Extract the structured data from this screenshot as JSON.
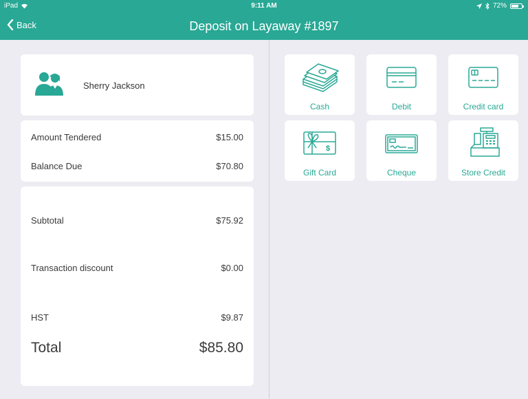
{
  "status_bar": {
    "carrier": "iPad",
    "time": "9:11 AM",
    "battery": "72%"
  },
  "nav": {
    "back_label": "Back",
    "title": "Deposit on Layaway #1897"
  },
  "customer": {
    "name": "Sherry Jackson"
  },
  "tender": {
    "amount_tendered_label": "Amount Tendered",
    "amount_tendered_value": "$15.00",
    "balance_due_label": "Balance Due",
    "balance_due_value": "$70.80"
  },
  "summary": {
    "subtotal_label": "Subtotal",
    "subtotal_value": "$75.92",
    "discount_label": "Transaction discount",
    "discount_value": "$0.00",
    "tax_label": "HST",
    "tax_value": "$9.87",
    "total_label": "Total",
    "total_value": "$85.80"
  },
  "payment_methods": [
    {
      "label": "Cash",
      "icon": "cash-icon"
    },
    {
      "label": "Debit",
      "icon": "debit-card-icon"
    },
    {
      "label": "Credit card",
      "icon": "credit-card-icon"
    },
    {
      "label": "Gift Card",
      "icon": "gift-card-icon"
    },
    {
      "label": "Cheque",
      "icon": "cheque-icon"
    },
    {
      "label": "Store Credit",
      "icon": "cash-register-icon"
    }
  ],
  "colors": {
    "accent": "#28a895",
    "background": "#ececf2",
    "card": "#ffffff"
  }
}
